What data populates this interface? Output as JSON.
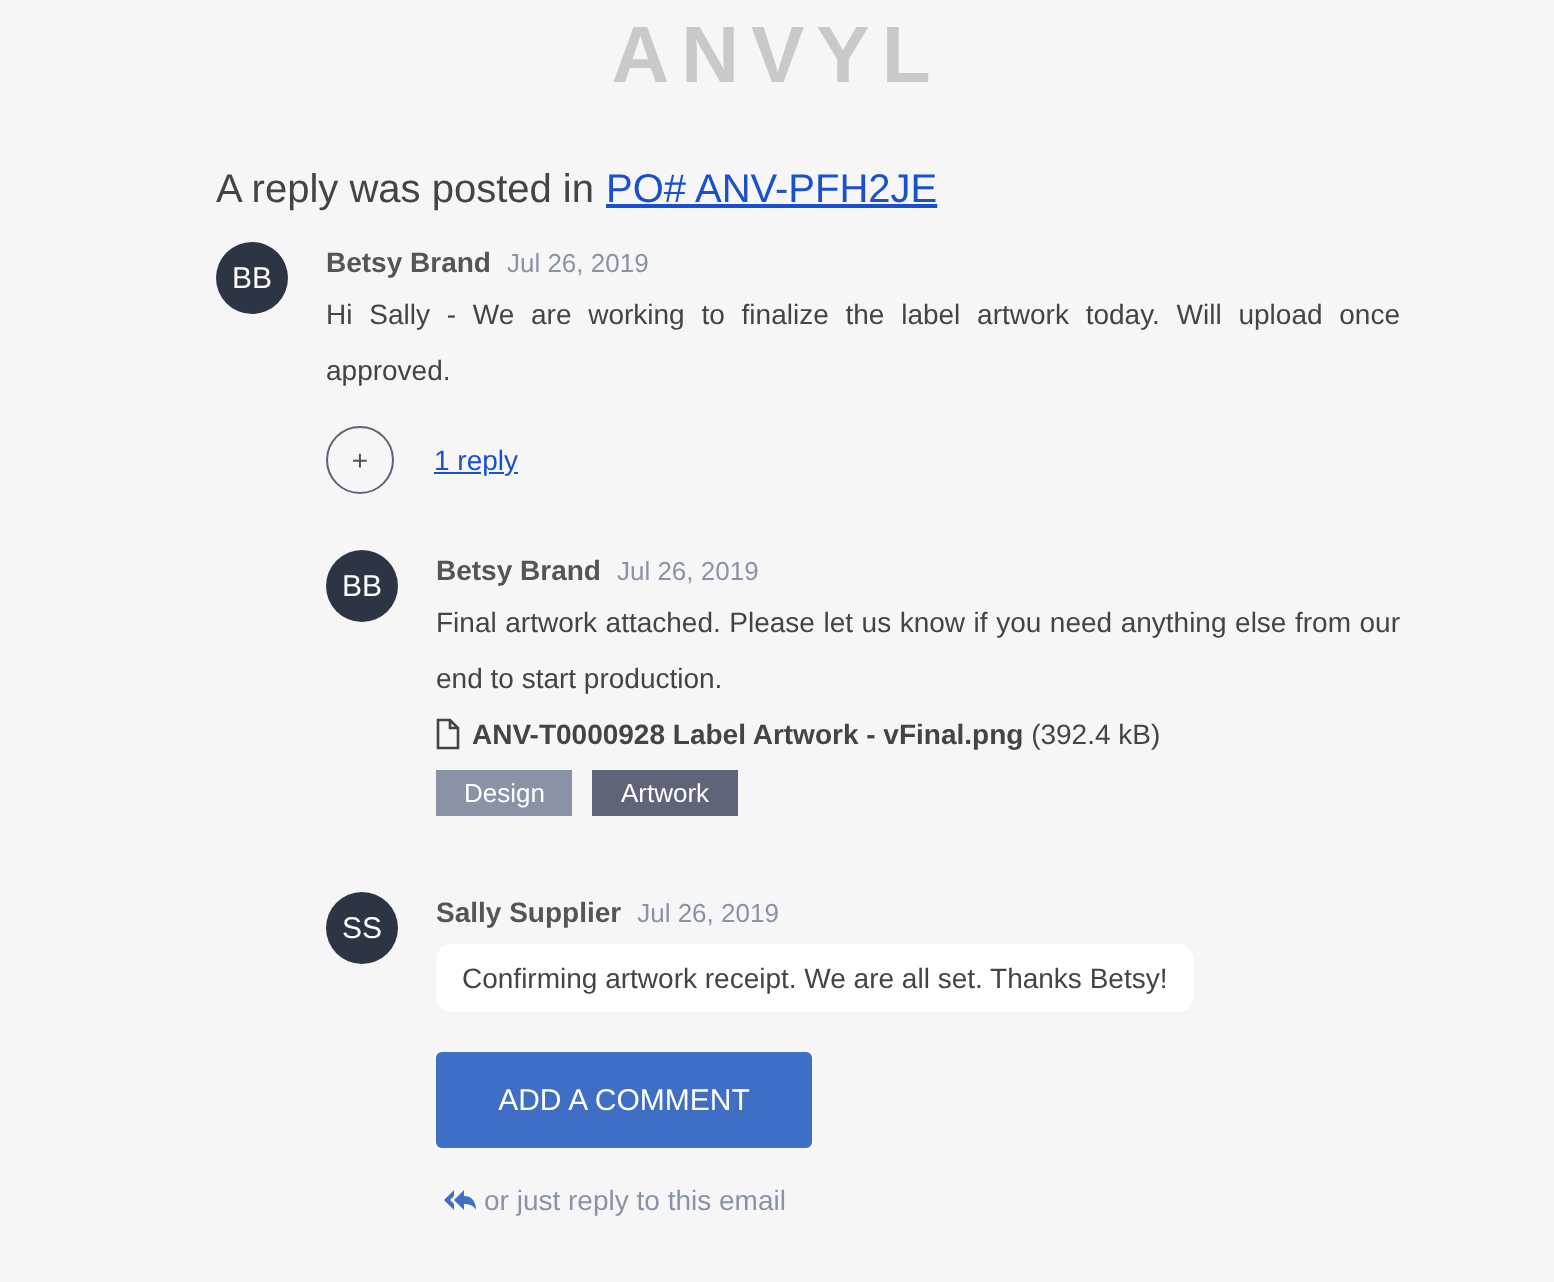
{
  "logo": "ANVYL",
  "heading": {
    "text": "A reply was posted in",
    "link": "PO# ANV-PFH2JE"
  },
  "comment": {
    "initials": "BB",
    "author": "Betsy Brand",
    "date": "Jul 26, 2019",
    "kind": "plain",
    "body": "Hi Sally - We are working to finalize the label artwork today. Will upload once approved.",
    "reply_toggle": {
      "icon": "+",
      "label": "1 reply"
    },
    "replies": [
      {
        "initials": "BB",
        "author": "Betsy Brand",
        "date": "Jul 26, 2019",
        "kind": "plain",
        "body": "Final artwork attached. Please let us know if you need anything else from our end to start production.",
        "attachment": {
          "name": "ANV-T0000928 Label Artwork - vFinal.png",
          "size": "(392.4 kB)"
        },
        "tags": [
          {
            "label": "Design",
            "color": "#8a93a6"
          },
          {
            "label": "Artwork",
            "color": "#5f6478"
          }
        ]
      },
      {
        "initials": "SS",
        "author": "Sally Supplier",
        "date": "Jul 26, 2019",
        "kind": "bubble",
        "body": "Confirming artwork receipt. We are all set. Thanks Betsy!"
      }
    ]
  },
  "button": "ADD A COMMENT",
  "footer": "or just reply to this email"
}
